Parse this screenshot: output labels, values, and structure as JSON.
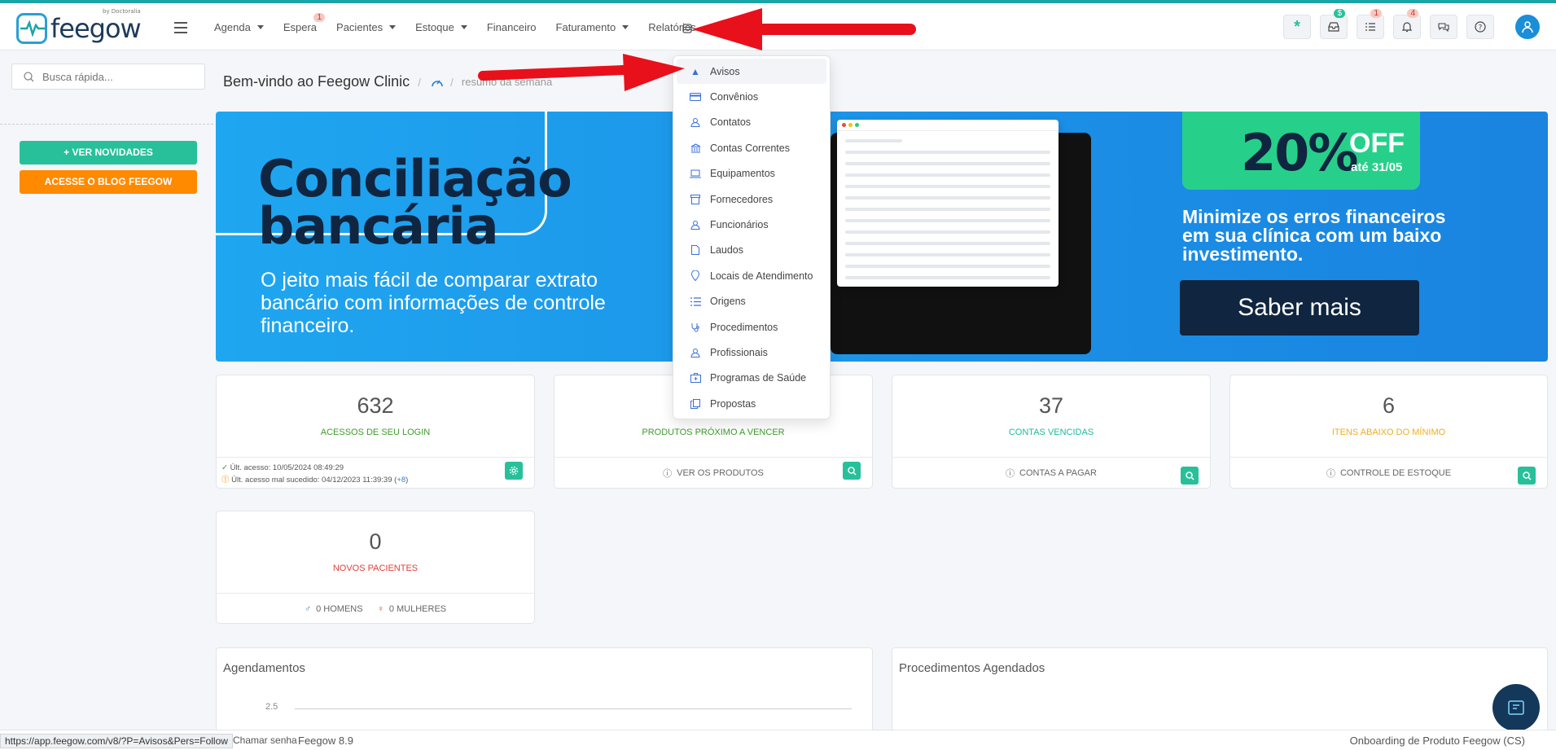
{
  "logo": {
    "text": "feegow",
    "by": "by Doctoralia"
  },
  "menu": [
    {
      "label": "Agenda",
      "caret": true
    },
    {
      "label": "Espera",
      "badge": "1"
    },
    {
      "label": "Pacientes",
      "caret": true
    },
    {
      "label": "Estoque",
      "caret": true
    },
    {
      "label": "Financeiro"
    },
    {
      "label": "Faturamento",
      "caret": true
    },
    {
      "label": "Relatórios"
    }
  ],
  "top_badges": {
    "dollar": "$",
    "tasks": "1",
    "bell": "4"
  },
  "search": {
    "placeholder": "Busca rápida..."
  },
  "sidebar": {
    "novidades": "+ VER NOVIDADES",
    "blog": "ACESSE O BLOG FEEGOW"
  },
  "breadcrumb": {
    "title": "Bem-vindo ao Feegow Clinic",
    "sub": "resumo da semana"
  },
  "banner": {
    "title_line1": "Conciliação",
    "title_line2": "bancária",
    "subtitle": "O jeito mais fácil de comparar extrato bancário com informações de controle financeiro.",
    "offer_pct": "20%",
    "offer_off": "OFF",
    "offer_until": "até 31/05",
    "minimize": "Minimize os erros financeiros em sua clínica com um baixo investimento.",
    "cta": "Saber mais"
  },
  "cards": {
    "login": {
      "num": "632",
      "label": "ACESSOS DE SEU LOGIN",
      "last": "Últ. acesso: 10/05/2024 08:49:29",
      "last_fail": "Últ. acesso mal sucedido: 04/12/2023 11:39:39 (",
      "more": "+8",
      "close": ")"
    },
    "produtos": {
      "label": "PRODUTOS PRÓXIMO A VENCER",
      "foot": "VER OS PRODUTOS"
    },
    "contas": {
      "num": "37",
      "label": "CONTAS VENCIDAS",
      "foot": "CONTAS A PAGAR"
    },
    "itens": {
      "num": "6",
      "label": "ITENS ABAIXO DO MÍNIMO",
      "foot": "CONTROLE DE ESTOQUE"
    },
    "pacientes": {
      "num": "0",
      "label": "NOVOS PACIENTES",
      "homens": "0 HOMENS",
      "mulheres": "0 MULHERES"
    }
  },
  "panels": {
    "agendamentos": "Agendamentos",
    "procedimentos": "Procedimentos Agendados",
    "y_tick": "2.5"
  },
  "dropdown": [
    {
      "label": "Avisos",
      "icon": "warning-icon"
    },
    {
      "label": "Convênios",
      "icon": "card-icon"
    },
    {
      "label": "Contatos",
      "icon": "person-icon"
    },
    {
      "label": "Contas Correntes",
      "icon": "bank-icon"
    },
    {
      "label": "Equipamentos",
      "icon": "laptop-icon"
    },
    {
      "label": "Fornecedores",
      "icon": "box-icon"
    },
    {
      "label": "Funcionários",
      "icon": "person-icon"
    },
    {
      "label": "Laudos",
      "icon": "document-icon"
    },
    {
      "label": "Locais de Atendimento",
      "icon": "pin-icon"
    },
    {
      "label": "Origens",
      "icon": "list-icon"
    },
    {
      "label": "Procedimentos",
      "icon": "stethoscope-icon"
    },
    {
      "label": "Profissionais",
      "icon": "person-icon"
    },
    {
      "label": "Programas de Saúde",
      "icon": "medkit-icon"
    },
    {
      "label": "Propostas",
      "icon": "copy-icon"
    }
  ],
  "statusbar": {
    "url": "https://app.feegow.com/v8/?P=Avisos&Pers=Follow",
    "chamar": "Chamar senha",
    "version": "Feegow 8.9",
    "onboarding": "Onboarding de Produto Feegow (CS)"
  },
  "colors": {
    "accent": "#27c09a",
    "brand": "#1b8ed8",
    "orange": "#ff8a00",
    "arrow": "#e8101a"
  }
}
